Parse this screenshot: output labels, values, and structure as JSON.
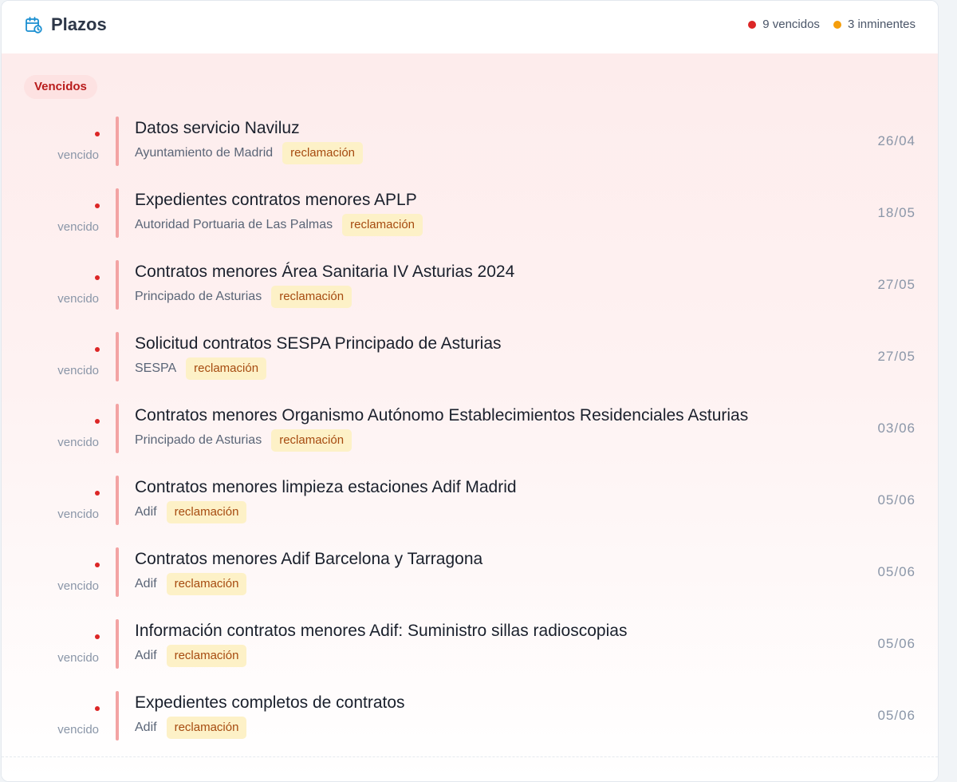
{
  "header": {
    "title": "Plazos",
    "icon": "calendar-clock-icon",
    "legend": [
      {
        "label": "9 vencidos",
        "color": "#dc2626"
      },
      {
        "label": "3 inminentes",
        "color": "#f59e0b"
      }
    ]
  },
  "section": {
    "badge": "Vencidos"
  },
  "rows": [
    {
      "status": "vencido",
      "title": "Datos servicio Naviluz",
      "org": "Ayuntamiento de Madrid",
      "tag": "reclamación",
      "date": "26/04"
    },
    {
      "status": "vencido",
      "title": "Expedientes contratos menores APLP",
      "org": "Autoridad Portuaria de Las Palmas",
      "tag": "reclamación",
      "date": "18/05"
    },
    {
      "status": "vencido",
      "title": "Contratos menores Área Sanitaria IV Asturias 2024",
      "org": "Principado de Asturias",
      "tag": "reclamación",
      "date": "27/05"
    },
    {
      "status": "vencido",
      "title": "Solicitud contratos SESPA Principado de Asturias",
      "org": "SESPA",
      "tag": "reclamación",
      "date": "27/05"
    },
    {
      "status": "vencido",
      "title": "Contratos menores Organismo Autónomo Establecimientos Residenciales Asturias",
      "org": "Principado de Asturias",
      "tag": "reclamación",
      "date": "03/06"
    },
    {
      "status": "vencido",
      "title": "Contratos menores limpieza estaciones Adif Madrid",
      "org": "Adif",
      "tag": "reclamación",
      "date": "05/06"
    },
    {
      "status": "vencido",
      "title": "Contratos menores Adif Barcelona y Tarragona",
      "org": "Adif",
      "tag": "reclamación",
      "date": "05/06"
    },
    {
      "status": "vencido",
      "title": "Información contratos menores Adif: Suministro sillas radioscopias",
      "org": "Adif",
      "tag": "reclamación",
      "date": "05/06"
    },
    {
      "status": "vencido",
      "title": "Expedientes completos de contratos",
      "org": "Adif",
      "tag": "reclamación",
      "date": "05/06"
    }
  ]
}
